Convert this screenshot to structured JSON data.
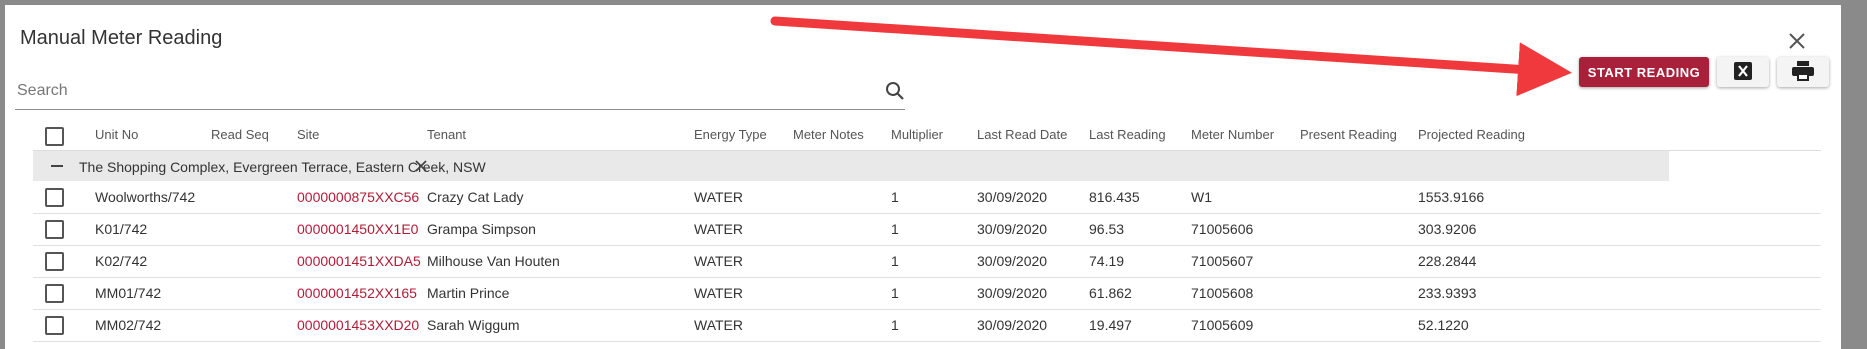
{
  "dialog": {
    "title": "Manual Meter Reading"
  },
  "search": {
    "placeholder": "Search",
    "value": ""
  },
  "toolbar": {
    "start_label": "START READING",
    "excel_icon": "excel-icon",
    "print_icon": "print-icon"
  },
  "colors": {
    "accent": "#a8203a",
    "link": "#b01c36",
    "arrow": "#f0393c"
  },
  "table": {
    "headers": {
      "unit_no": "Unit No",
      "read_seq": "Read Seq",
      "site": "Site",
      "tenant": "Tenant",
      "energy_type": "Energy Type",
      "meter_notes": "Meter Notes",
      "multiplier": "Multiplier",
      "last_read_date": "Last Read Date",
      "last_reading": "Last Reading",
      "meter_number": "Meter Number",
      "present_reading": "Present Reading",
      "projected_reading": "Projected Reading"
    },
    "group_label": "The Shopping Complex, Evergreen Terrace, Eastern Creek, NSW",
    "rows": [
      {
        "unit": "Woolworths/742",
        "site": "0000000875XXC56",
        "tenant": "Crazy Cat Lady",
        "energy": "WATER",
        "multiplier": "1",
        "date": "30/09/2020",
        "last": "816.435",
        "meter": "W1",
        "projected": "1553.9166"
      },
      {
        "unit": "K01/742",
        "site": "0000001450XX1E0",
        "tenant": "Grampa Simpson",
        "energy": "WATER",
        "multiplier": "1",
        "date": "30/09/2020",
        "last": "96.53",
        "meter": "71005606",
        "projected": "303.9206"
      },
      {
        "unit": "K02/742",
        "site": "0000001451XXDA5",
        "tenant": "Milhouse Van Houten",
        "energy": "WATER",
        "multiplier": "1",
        "date": "30/09/2020",
        "last": "74.19",
        "meter": "71005607",
        "projected": "228.2844"
      },
      {
        "unit": "MM01/742",
        "site": "0000001452XX165",
        "tenant": "Martin Prince",
        "energy": "WATER",
        "multiplier": "1",
        "date": "30/09/2020",
        "last": "61.862",
        "meter": "71005608",
        "projected": "233.9393"
      },
      {
        "unit": "MM02/742",
        "site": "0000001453XXD20",
        "tenant": "Sarah Wiggum",
        "energy": "WATER",
        "multiplier": "1",
        "date": "30/09/2020",
        "last": "19.497",
        "meter": "71005609",
        "projected": "52.1220"
      }
    ]
  }
}
